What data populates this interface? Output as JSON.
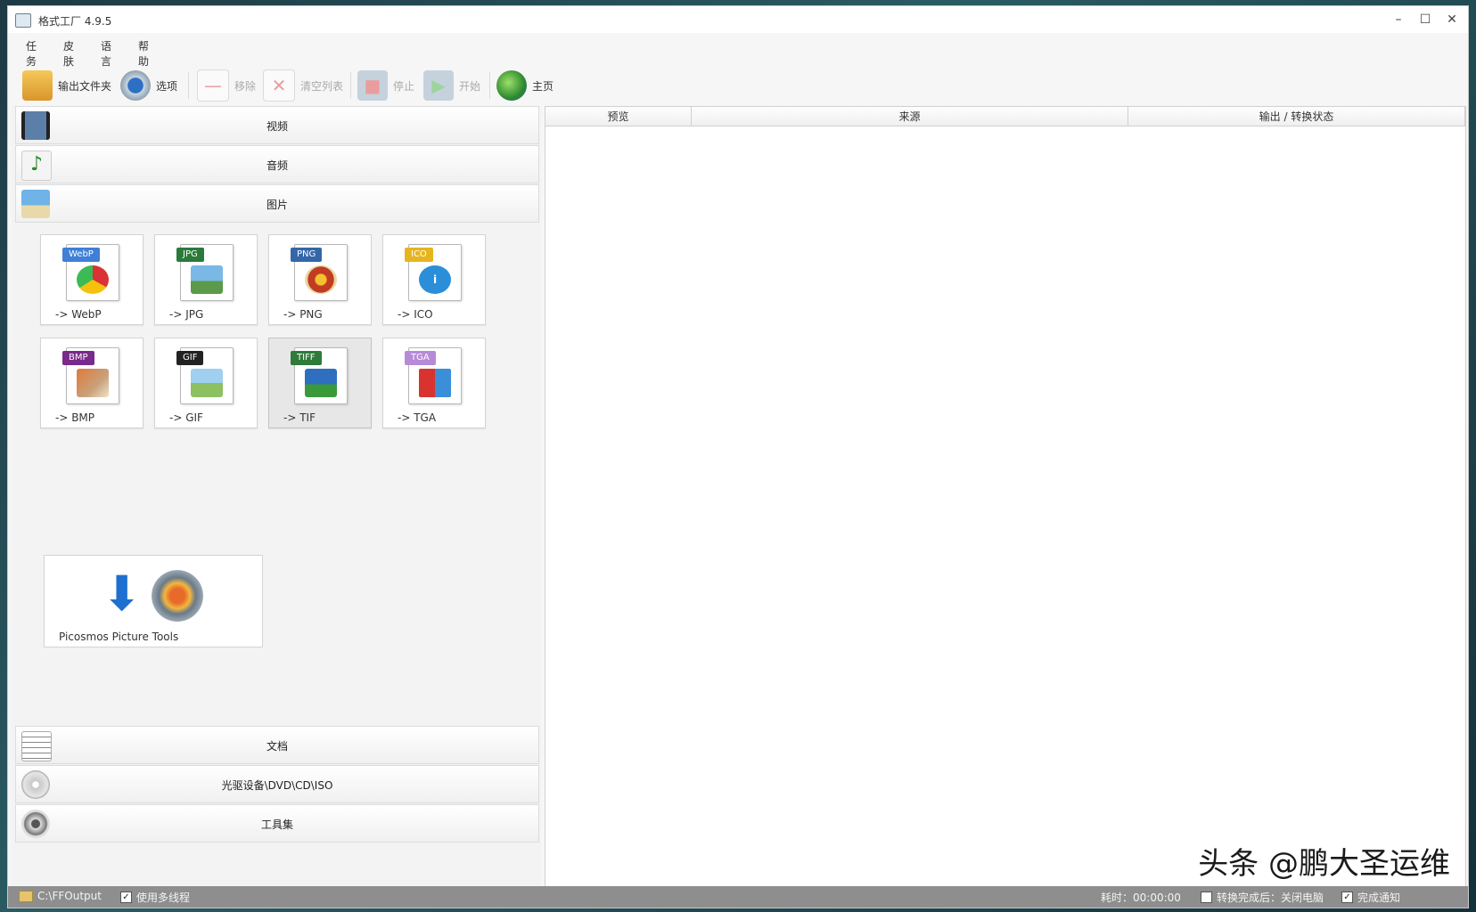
{
  "window": {
    "title": "格式工厂 4.9.5"
  },
  "menus": [
    "任务",
    "皮肤",
    "语言",
    "帮助"
  ],
  "toolbar": {
    "output_folder": "输出文件夹",
    "options": "选项",
    "remove": "移除",
    "clear_list": "清空列表",
    "stop": "停止",
    "start": "开始",
    "home": "主页"
  },
  "categories": {
    "video": "视频",
    "audio": "音频",
    "image": "图片",
    "document": "文档",
    "disc": "光驱设备\\DVD\\CD\\ISO",
    "tools": "工具集"
  },
  "image_tiles": [
    {
      "badge": "WebP",
      "label": "-> WebP",
      "badge_color": "#3f7fd6"
    },
    {
      "badge": "JPG",
      "label": "-> JPG",
      "badge_color": "#2a7a3a"
    },
    {
      "badge": "PNG",
      "label": "-> PNG",
      "badge_color": "#3466a8"
    },
    {
      "badge": "ICO",
      "label": "-> ICO",
      "badge_color": "#e6b51e"
    },
    {
      "badge": "BMP",
      "label": "-> BMP",
      "badge_color": "#7a2a8a"
    },
    {
      "badge": "GIF",
      "label": "-> GIF",
      "badge_color": "#222222"
    },
    {
      "badge": "TIFF",
      "label": "-> TIF",
      "badge_color": "#2e7b3a"
    },
    {
      "badge": "TGA",
      "label": "-> TGA",
      "badge_color": "#b78ad8"
    }
  ],
  "extra_tool": {
    "label": "Picosmos Picture Tools"
  },
  "table": {
    "columns": [
      "预览",
      "来源",
      "输出 / 转换状态"
    ]
  },
  "status": {
    "output_path": "C:\\FFOutput",
    "multithread": "使用多线程",
    "elapsed": "耗时：00:00:00",
    "after_convert": "转换完成后：关闭电脑",
    "notify": "完成通知"
  },
  "watermark": "头条 @鹏大圣运维"
}
